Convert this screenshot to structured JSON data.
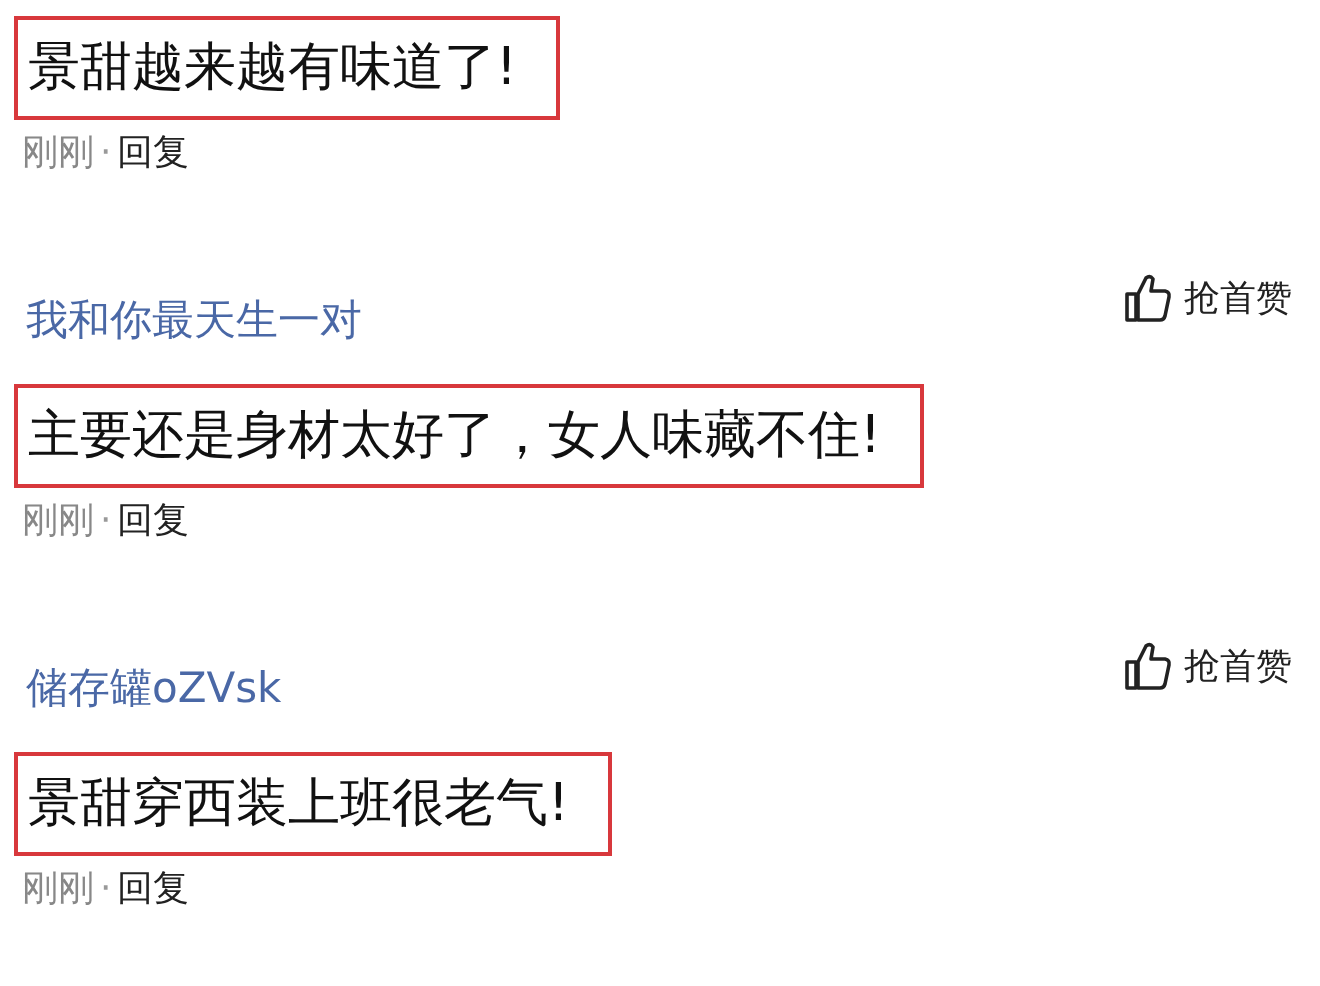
{
  "comments": [
    {
      "body": "景甜越来越有味道了!",
      "highlighted": true,
      "time": "刚刚",
      "separator": "·",
      "reply": "回复"
    },
    {
      "user": "我和你最天生一对",
      "like": "抢首赞",
      "body": "主要还是身材太好了，女人味藏不住!",
      "highlighted": true,
      "time": "刚刚",
      "separator": "·",
      "reply": "回复"
    },
    {
      "user": "储存罐oZVsk",
      "like": "抢首赞",
      "body": "景甜穿西装上班很老气!",
      "highlighted": true,
      "time": "刚刚",
      "separator": "·",
      "reply": "回复"
    }
  ]
}
